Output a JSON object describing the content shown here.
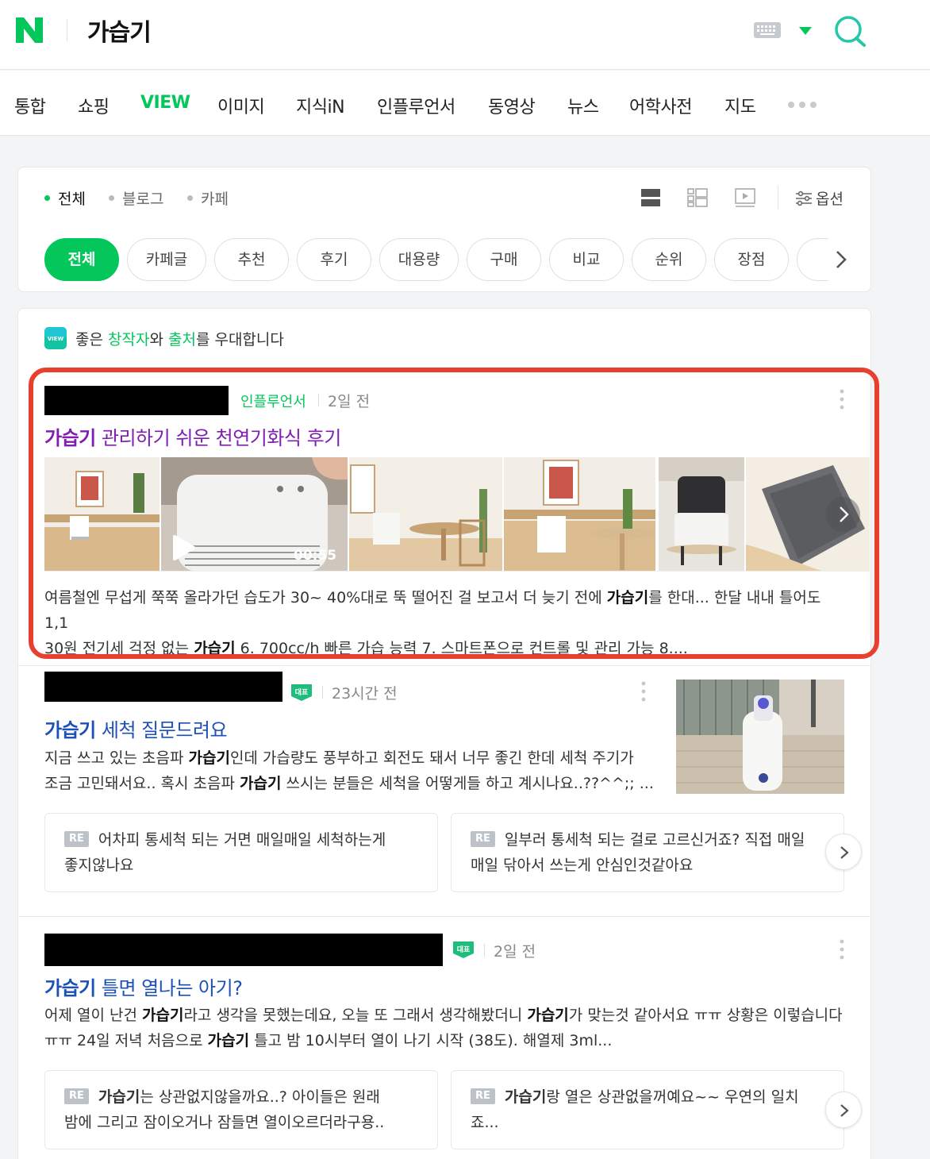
{
  "header": {
    "logo": "N",
    "query": "가습기",
    "keyboard_icon": "keyboard-icon",
    "dropdown_icon": "caret-down-icon",
    "search_icon": "search-icon",
    "accent_color": "#03c75a"
  },
  "tabs": [
    {
      "label": "통합"
    },
    {
      "label": "쇼핑"
    },
    {
      "label": "VIEW",
      "active": true
    },
    {
      "label": "이미지"
    },
    {
      "label": "지식iN"
    },
    {
      "label": "인플루언서"
    },
    {
      "label": "동영상"
    },
    {
      "label": "뉴스"
    },
    {
      "label": "어학사전"
    },
    {
      "label": "지도"
    }
  ],
  "filter": {
    "subtabs": [
      {
        "label": "전체",
        "active": true
      },
      {
        "label": "블로그"
      },
      {
        "label": "카페"
      }
    ],
    "view_icons": [
      "list-view-icon",
      "thumbnail-list-icon",
      "video-view-icon"
    ],
    "option_label": "옵션",
    "chips": [
      {
        "label": "전체",
        "active": true
      },
      {
        "label": "카페글"
      },
      {
        "label": "추천"
      },
      {
        "label": "후기"
      },
      {
        "label": "대용량"
      },
      {
        "label": "구매"
      },
      {
        "label": "비교"
      },
      {
        "label": "순위"
      },
      {
        "label": "장점"
      }
    ]
  },
  "notice": {
    "prefix": "좋은 ",
    "highlight1": "창작자",
    "middle": "와 ",
    "highlight2": "출처",
    "suffix": "를 우대합니다"
  },
  "results": [
    {
      "source_label": "인플루언서",
      "time": "2일 전",
      "title_keyword": "가습기",
      "title_rest": " 관리하기 쉬운 천연기화식 후기",
      "video_duration": "00:55",
      "desc": [
        {
          "t": "여름철엔 무섭게 쭉쭉 올라가던 습도가 30~ 40%대로 뚝 떨어진 걸 보고서 더 늦기 전에 "
        },
        {
          "b": "가습기"
        },
        {
          "t": "를 한대... 한달 내내 틀어도 1,1"
        },
        {
          "br": true
        },
        {
          "t": "30원 전기세 걱정 없는 "
        },
        {
          "b": "가습기"
        },
        {
          "t": " 6. 700cc/h 빠른 가습 능력 7. 스마트폰으로 컨트롤 및 관리 가능 8...."
        }
      ],
      "highlight_color": "#e8402e"
    },
    {
      "badge": "대표",
      "time": "23시간 전",
      "title_keyword": "가습기",
      "title_rest": " 세척 질문드려요",
      "desc": [
        {
          "t": "지금 쓰고 있는 초음파 "
        },
        {
          "b": "가습기"
        },
        {
          "t": "인데 가습량도 풍부하고 회전도 돼서 너무 좋긴 한데 세척 주기가"
        },
        {
          "br": true
        },
        {
          "t": "조금 고민돼서요.. 혹시 초음파 "
        },
        {
          "b": "가습기"
        },
        {
          "t": " 쓰시는 분들은 세척을 어떻게들 하고 계시나요..??^^;; ..."
        }
      ],
      "replies": [
        {
          "tag": "RE",
          "segments": [
            {
              "t": "어차피 통세척 되는 거면 매일매일 세척하는게"
            },
            {
              "br": true
            },
            {
              "t": "좋지않나요"
            }
          ]
        },
        {
          "tag": "RE",
          "segments": [
            {
              "t": "일부러 통세척 되는 걸로 고르신거죠? 직접 매일"
            },
            {
              "br": true
            },
            {
              "t": "매일 닦아서 쓰는게 안심인것같아요"
            }
          ]
        }
      ]
    },
    {
      "badge": "대표",
      "time": "2일 전",
      "title_keyword": "가습기",
      "title_rest": " 틀면 열나는 아기?",
      "desc": [
        {
          "t": "어제 열이 난건 "
        },
        {
          "b": "가습기"
        },
        {
          "t": "라고 생각을 못했는데요, 오늘 또 그래서 생각해봤더니 "
        },
        {
          "b": "가습기"
        },
        {
          "t": "가 맞는것 같아서요 ㅠㅠ 상황은 이렇습니다"
        },
        {
          "br": true
        },
        {
          "t": "ㅠㅠ 24일 저녁 처음으로 "
        },
        {
          "b": "가습기"
        },
        {
          "t": " 틀고 밤 10시부터 열이 나기 시작 (38도). 해열제 3ml..."
        }
      ],
      "replies": [
        {
          "tag": "RE",
          "segments": [
            {
              "b": "가습기"
            },
            {
              "t": "는 상관없지않을까요..? 아이들은 원래"
            },
            {
              "br": true
            },
            {
              "t": "밤에 그리고 잠이오거나 잠들면 열이오르더라구용.."
            }
          ]
        },
        {
          "tag": "RE",
          "segments": [
            {
              "b": "가습기"
            },
            {
              "t": "랑 열은 상관없을꺼예요~~ 우연의 일치"
            },
            {
              "br": true
            },
            {
              "t": "죠..."
            }
          ]
        }
      ]
    }
  ]
}
